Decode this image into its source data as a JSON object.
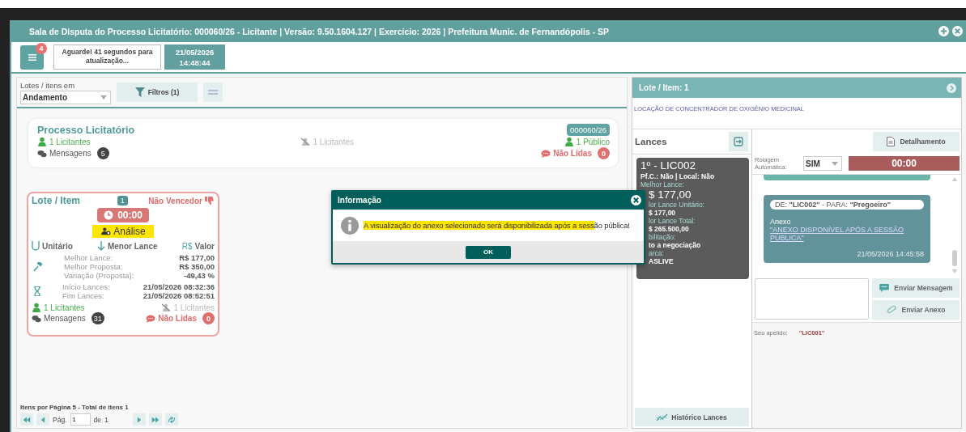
{
  "window": {
    "title": "Sala de Disputa do Processo Licitatório: 000060/26 - Licitante | Versão: 9.50.1604.127 | Exercicio: 2026 | Prefeitura Munic. de Fernandópolis - SP"
  },
  "toolbar": {
    "menu_badge": "4",
    "refresh_notice": "Aguarde! 41 segundos para atualização...",
    "date": "21/05/2026",
    "time": "14:48:44"
  },
  "filters": {
    "label": "Lotes / itens em",
    "status_value": "Andamento",
    "filter_button": "Filtros (1)"
  },
  "process_card": {
    "title": "Processo Licitatório",
    "number": "000060/26",
    "bidders": "1 Licitantes",
    "inactive_bidders": "1 Licitantes",
    "public": "1 Público",
    "messages_label": "Mensagens",
    "messages_count": "5",
    "unread_label": "Não Lidas",
    "unread_count": "0"
  },
  "lot_cards": [
    {
      "title": "Lote / Item",
      "number": "1",
      "result": "Não Vencedor",
      "timer": "00:00",
      "status": "Análise",
      "status_highlighted": true,
      "criteria": [
        {
          "kind": "unit",
          "label": "Unitário"
        },
        {
          "kind": "lowest",
          "label": "Menor Lance"
        },
        {
          "kind": "currency",
          "symbol": "R$",
          "label": "Valor"
        }
      ],
      "bids": [
        {
          "label": "Melhor Lance:",
          "value": "R$ 177,00"
        },
        {
          "label": "Melhor Proposta:",
          "value": "R$ 350,00"
        },
        {
          "label": "Variação (Proposta):",
          "value": "-49,43 %"
        }
      ],
      "schedule": [
        {
          "label": "Início Lances:",
          "value": "21/05/2026 08:32:36"
        },
        {
          "label": "Fim Lances:",
          "value": "21/05/2026 08:52:51"
        }
      ],
      "bidders": "1 Licitantes",
      "inactive_bidders": "1 Licitantes",
      "messages_label": "Mensagens",
      "messages_count": "31",
      "unread_label": "Não Lidas",
      "unread_count": "0"
    }
  ],
  "pagination": {
    "summary": "Itens por Página 5 - Total de itens 1",
    "page_label": "Pág.",
    "page": "1",
    "of_label": "de",
    "total_pages": "1"
  },
  "detail": {
    "title": "Lote / Item: 1",
    "description": "LOCAÇÃO DE CONCENTRADOR DE OXIGÊNIO MEDICINAL"
  },
  "bids_panel": {
    "title": "Lances",
    "history_button": "Histórico Lances",
    "ranking": [
      {
        "lines": [
          {
            "kind": "title",
            "text": "1º - LIC002",
            "clipped": false
          },
          {
            "kind": "info",
            "text": "Pf.C.: Não | Local: Não",
            "clipped": false
          },
          {
            "kind": "label",
            "text": "Melhor Lance:",
            "clipped": false
          },
          {
            "kind": "amount",
            "text": "$ 177,00",
            "clipped": true
          },
          {
            "kind": "label",
            "text": "lor Lance Unitário:",
            "clipped": true
          },
          {
            "kind": "info",
            "text": "$ 177,00",
            "clipped": true
          },
          {
            "kind": "label",
            "text": "lor Lance Total:",
            "clipped": true
          },
          {
            "kind": "info",
            "text": "$ 265.500,00",
            "clipped": true
          },
          {
            "kind": "label",
            "text": "bilitação:",
            "clipped": true
          },
          {
            "kind": "info",
            "text": "to a negociação",
            "clipped": true
          },
          {
            "kind": "label",
            "text": "arca:",
            "clipped": true
          },
          {
            "kind": "info",
            "text": "ASLIVE",
            "clipped": true
          }
        ]
      }
    ]
  },
  "chat": {
    "detail_button": "Detalhamento",
    "autoscroll_label": "Rolagem Automática:",
    "autoscroll_value": "SIM",
    "timer": "00:00",
    "messages": [
      {
        "header": "DE: **\"LIC002\"** - PARA: **\"Pregoeiro\"**",
        "body": "Anexo",
        "link": "\"ANEXO DISPONÍVEL APÓS A SESSÃO PÚBLICA\"",
        "time": "21/05/2026 14:45:58"
      }
    ],
    "send_message_button": "Enviar Mensagem",
    "send_attachment_button": "Enviar Anexo",
    "nickname_label": "Seu apelido:",
    "nickname": "\"LIC001\""
  },
  "dialog": {
    "title": "Informação",
    "message": [
      {
        "text": "A visualização do anexo selecionado será disponibilizada após a sess",
        "highlighted": true
      },
      {
        "text": "ão pública!",
        "highlighted": false
      }
    ],
    "ok_button": "OK"
  }
}
